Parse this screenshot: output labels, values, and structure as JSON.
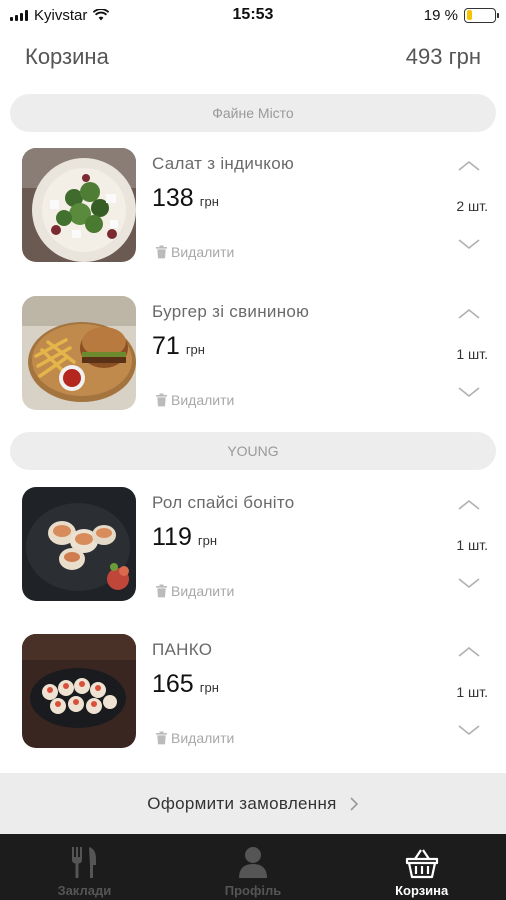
{
  "status_bar": {
    "carrier": "Kyivstar",
    "time": "15:53",
    "battery": "19 %",
    "battery_level": 0.19
  },
  "header": {
    "title": "Корзина",
    "total": "493 грн"
  },
  "sections": [
    {
      "name": "Файне Місто"
    },
    {
      "name": "YOUNG"
    }
  ],
  "items": [
    {
      "name": "Салат з індичкою",
      "price": "138",
      "currency": "грн",
      "quantity": "2 шт.",
      "remove_label": "Видалити",
      "image_icon": "salad-photo"
    },
    {
      "name": "Бургер зі свининою",
      "price": "71",
      "currency": "грн",
      "quantity": "1 шт.",
      "remove_label": "Видалити",
      "image_icon": "burger-photo"
    },
    {
      "name": "Рол  спайсі боніто",
      "price": "119",
      "currency": "грн",
      "quantity": "1 шт.",
      "remove_label": "Видалити",
      "image_icon": "roll-photo"
    },
    {
      "name": "ПАНКО",
      "price": "165",
      "currency": "грн",
      "quantity": "1 шт.",
      "remove_label": "Видалити",
      "image_icon": "sushi-photo"
    }
  ],
  "checkout": {
    "label": "Оформити замовлення"
  },
  "tabs": [
    {
      "label": "Заклади",
      "icon": "fork-knife-icon",
      "active": false
    },
    {
      "label": "Профіль",
      "icon": "user-icon",
      "active": false
    },
    {
      "label": "Корзина",
      "icon": "basket-icon",
      "active": true
    }
  ],
  "colors": {
    "accent_battery": "#f5c400",
    "tab_bar_bg": "#1c1c1c",
    "pill_bg": "#ededed"
  }
}
